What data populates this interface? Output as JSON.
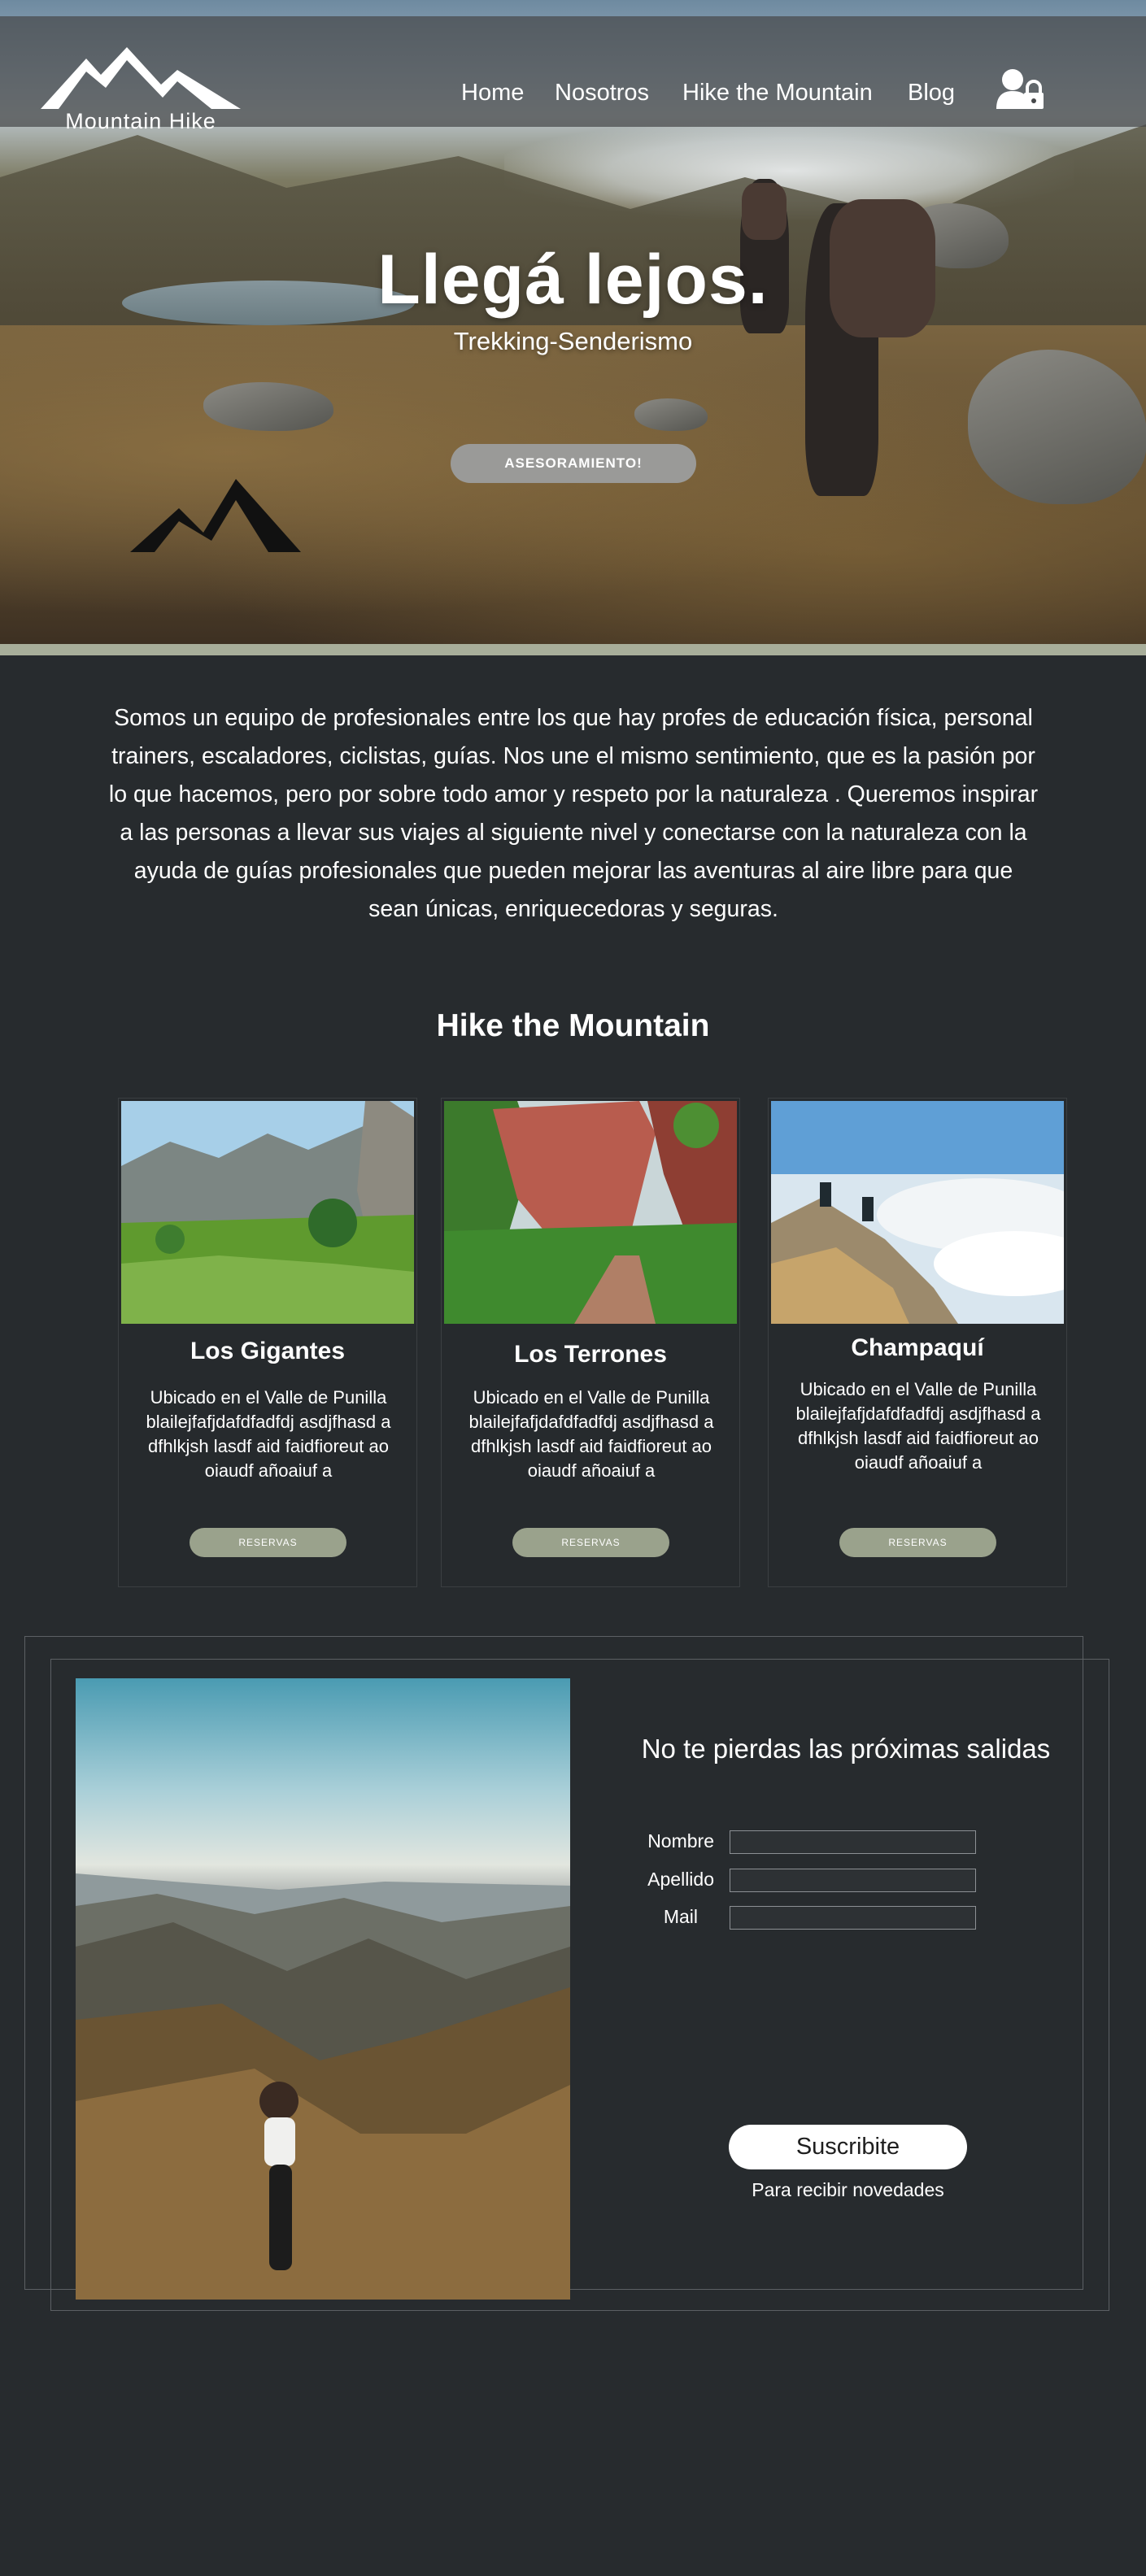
{
  "nav": {
    "logo_text": "Mountain Hike",
    "items": [
      {
        "label": "Home"
      },
      {
        "label": "Nosotros"
      },
      {
        "label": "Hike the Mountain"
      },
      {
        "label": "Blog"
      }
    ],
    "user_icon": "user-lock-icon"
  },
  "hero": {
    "title": "Llegá lejos.",
    "subtitle": "Trekking-Senderismo",
    "button_label": "ASESORAMIENTO!"
  },
  "intro": {
    "text": "Somos un equipo de profesionales entre los que  hay profes de educación física, personal trainers, escaladores, ciclistas, guías. Nos une el mismo sentimiento,  que es la pasión por lo que hacemos, pero por sobre todo amor y respeto por la naturaleza . Queremos inspirar a las personas a llevar sus viajes al siguiente nivel y conectarse con la naturaleza con la ayuda de guías profesionales que pueden mejorar las aventuras al aire libre para que sean únicas, enriquecedoras y seguras."
  },
  "section": {
    "title": "Hike the Mountain"
  },
  "cards": [
    {
      "title": "Los Gigantes",
      "description": "Ubicado en el Valle de Punilla blailejfafjdafdfadfdj asdjfhasd a dfhlkjsh lasdf aid faidfioreut ao oiaudf añoaiuf a",
      "button_label": "RESERVAS"
    },
    {
      "title": "Los Terrones",
      "description": "Ubicado en el Valle de Punilla blailejfafjdafdfadfdj asdjfhasd a dfhlkjsh lasdf aid faidfioreut ao oiaudf añoaiuf a",
      "button_label": "RESERVAS"
    },
    {
      "title": "Champaquí",
      "description": "Ubicado en el Valle de Punilla blailejfafjdafdfadfdj asdjfhasd a dfhlkjsh lasdf aid faidfioreut ao oiaudf añoaiuf a",
      "button_label": "RESERVAS"
    }
  ],
  "subscribe": {
    "title": "No te pierdas las próximas salidas",
    "fields": [
      {
        "label": "Nombre",
        "value": ""
      },
      {
        "label": "Apellido",
        "value": ""
      },
      {
        "label": "Mail",
        "value": ""
      }
    ],
    "button_label": "Suscribite",
    "note": "Para recibir novedades"
  },
  "colors": {
    "background": "#272b2e",
    "accent_sage": "#9aa28c",
    "navbar": "#46484a"
  }
}
